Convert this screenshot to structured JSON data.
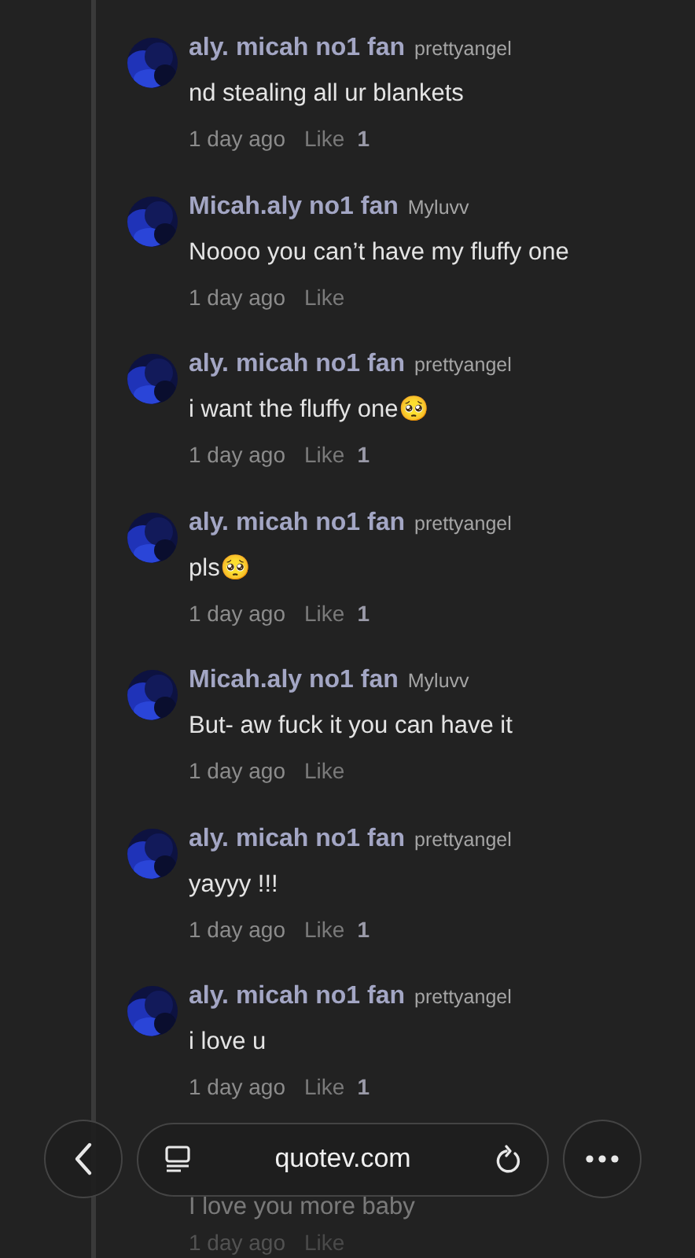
{
  "comments": [
    {
      "name": "aly. micah no1 fan",
      "username": "prettyangel",
      "message": "nd stealing all ur blankets",
      "time": "1 day ago",
      "like_label": "Like",
      "likes": "1"
    },
    {
      "name": "Micah.aly no1 fan",
      "username": "Myluvv",
      "message": "Noooo you can’t have my fluffy one",
      "time": "1 day ago",
      "like_label": "Like"
    },
    {
      "name": "aly. micah no1 fan",
      "username": "prettyangel",
      "message": "i want the fluffy one🥺",
      "time": "1 day ago",
      "like_label": "Like",
      "likes": "1"
    },
    {
      "name": "aly. micah no1 fan",
      "username": "prettyangel",
      "message": "pls🥺",
      "time": "1 day ago",
      "like_label": "Like",
      "likes": "1"
    },
    {
      "name": "Micah.aly no1 fan",
      "username": "Myluvv",
      "message": "But- aw fuck it you can have it",
      "time": "1 day ago",
      "like_label": "Like"
    },
    {
      "name": "aly. micah no1 fan",
      "username": "prettyangel",
      "message": "yayyy !!!",
      "time": "1 day ago",
      "like_label": "Like",
      "likes": "1"
    },
    {
      "name": "aly. micah no1 fan",
      "username": "prettyangel",
      "message": "i love u",
      "time": "1 day ago",
      "like_label": "Like",
      "likes": "1"
    },
    {
      "message": "I love you more baby",
      "time": "1 day ago",
      "like_label": "Like"
    }
  ],
  "browser_bar": {
    "url": "quotev.com"
  }
}
